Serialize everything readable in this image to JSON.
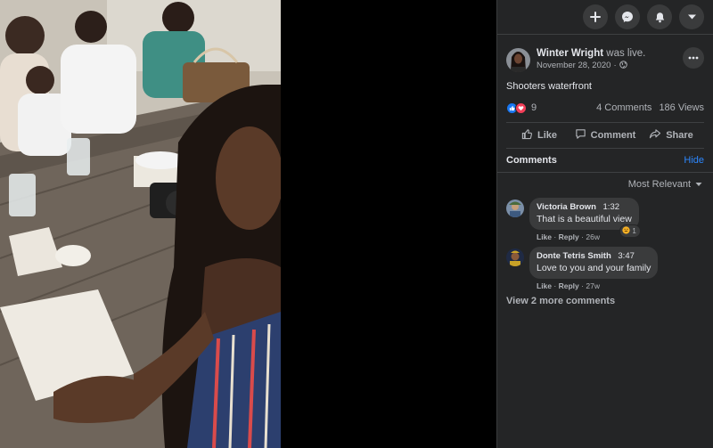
{
  "topbar": {
    "icons": [
      "plus-icon",
      "messenger-icon",
      "notifications-bell-icon",
      "account-dropdown-icon"
    ]
  },
  "post": {
    "author": "Winter Wright",
    "status": "was live.",
    "date": "November 28, 2020",
    "date_separator": "·",
    "privacy_icon": "globe-icon",
    "text": "Shooters waterfront",
    "reaction_count": "9",
    "reaction_icons": [
      "like-icon",
      "love-icon"
    ],
    "comments_count": "4 Comments",
    "views_count": "186 Views"
  },
  "actions": {
    "like": "Like",
    "comment": "Comment",
    "share": "Share"
  },
  "comments_section": {
    "title": "Comments",
    "hide": "Hide",
    "sort": "Most Relevant",
    "items": [
      {
        "name": "Victoria Brown",
        "time": "1:32",
        "text": "That is a beautiful view",
        "like": "Like",
        "reply": "Reply",
        "age": "26w",
        "reaction_count": "1"
      },
      {
        "name": "Donte Tetris Smith",
        "time": "3:47",
        "text": "Love to you and your family",
        "like": "Like",
        "reply": "Reply",
        "age": "27w"
      }
    ],
    "view_more": "View 2 more comments"
  },
  "colors": {
    "panel_bg": "#242526",
    "bubble_bg": "#3a3b3c",
    "link_blue": "#2d88ff",
    "like_blue": "#1877f2",
    "love_red": "#f33e58"
  }
}
